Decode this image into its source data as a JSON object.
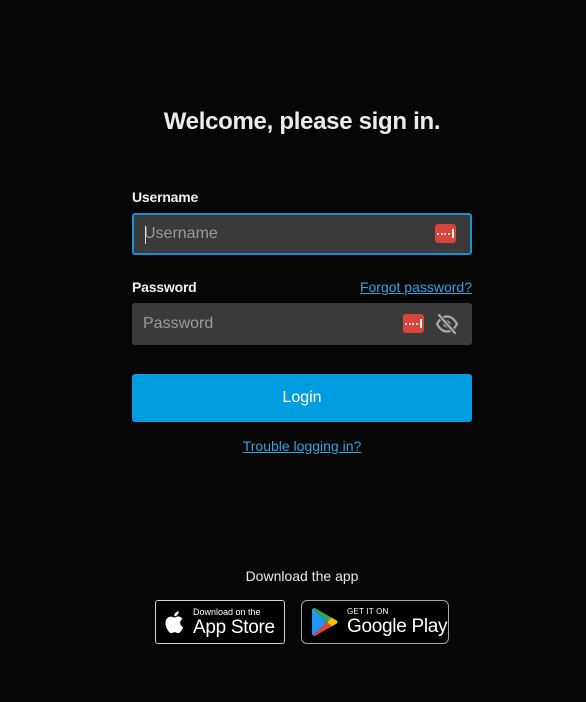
{
  "heading": "Welcome, please sign in.",
  "username": {
    "label": "Username",
    "placeholder": "Username",
    "value": ""
  },
  "password": {
    "label": "Password",
    "placeholder": "Password",
    "value": "",
    "forgot_link": "Forgot password?"
  },
  "login_button": "Login",
  "trouble_link": "Trouble logging in?",
  "download": {
    "label": "Download the app",
    "app_store": {
      "small_text": "Download on the",
      "big_text": "App Store"
    },
    "google_play": {
      "small_text": "GET IT ON",
      "big_text": "Google Play"
    }
  },
  "icons": {
    "password_manager": "password-manager-icon",
    "show_password": "eye-slash-icon",
    "apple": "apple-logo-icon",
    "google_play": "google-play-logo-icon"
  },
  "colors": {
    "background": "#060606",
    "accent": "#009ee0",
    "link": "#2ea6e6",
    "input_background": "#3a3a3a",
    "password_manager_icon": "#d9453c"
  }
}
